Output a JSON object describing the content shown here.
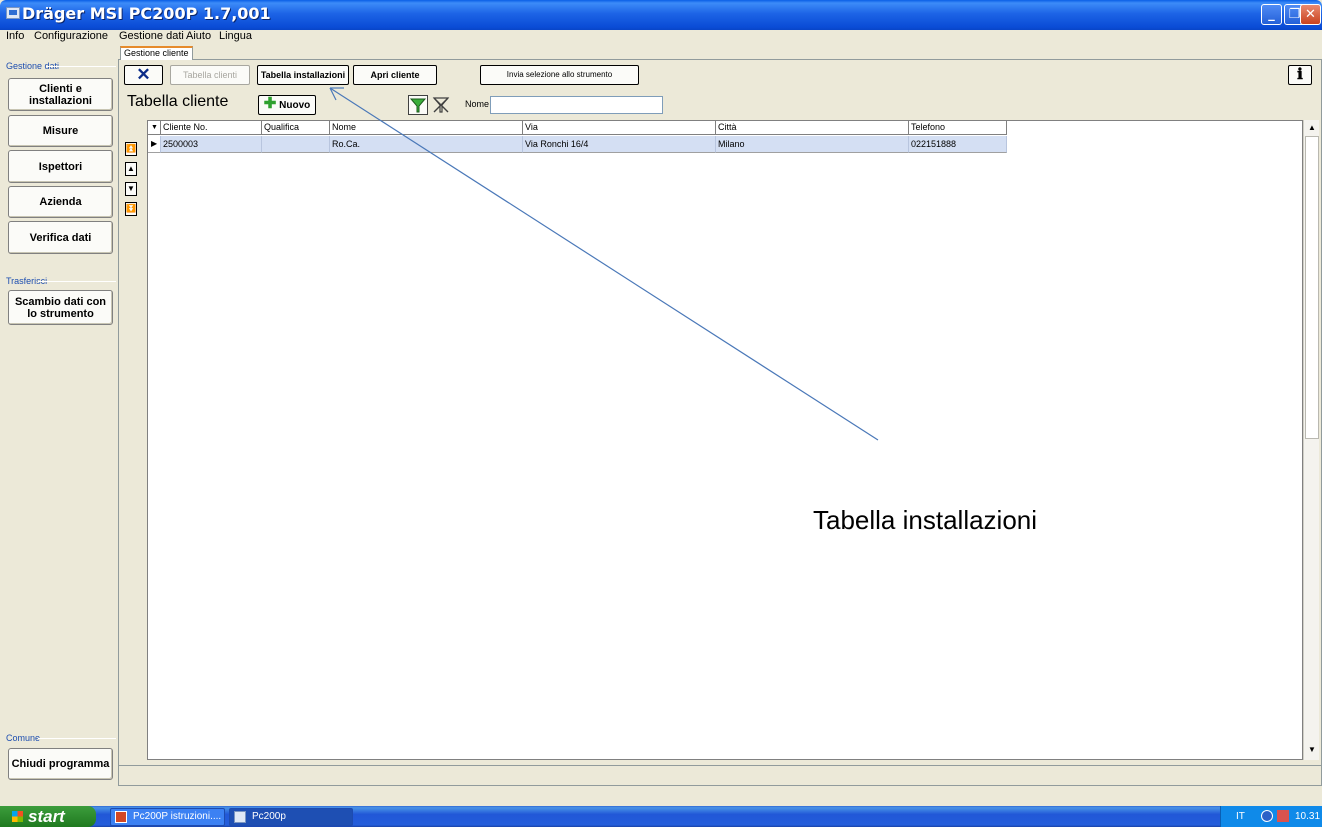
{
  "window": {
    "title": "Dräger MSI PC200P 1.7,001",
    "minimize": "_",
    "restore": "❐",
    "close": "✕"
  },
  "menu": [
    "Info",
    "Configurazione",
    "Gestione dati",
    "Aiuto",
    "Lingua"
  ],
  "sidebar": {
    "group_data": "Gestione dati",
    "group_transfer": "Trasferisci",
    "group_common": "Comune",
    "buttons": {
      "clients": "Clienti e installazioni",
      "measures": "Misure",
      "inspectors": "Ispettori",
      "company": "Azienda",
      "verify": "Verifica dati",
      "exchange": "Scambio dati con lo strumento",
      "close_program": "Chiudi programma"
    }
  },
  "tab": {
    "label": "Gestione cliente"
  },
  "toolbar": {
    "close_icon": "close-icon",
    "tabella_clienti": "Tabella clienti",
    "tabella_installazioni": "Tabella installazioni",
    "apri_cliente": "Apri cliente",
    "invia_selezione": "Invia selezione allo strumento",
    "info_icon": "info-icon"
  },
  "section": {
    "title": "Tabella cliente",
    "new_button": "Nuovo",
    "filter_label": "Nome",
    "filter_value": ""
  },
  "table": {
    "columns": [
      "Cliente No.",
      "Qualifica",
      "Nome",
      "Via",
      "Città",
      "Telefono"
    ],
    "rows": [
      [
        "2500003",
        "",
        "Ro.Ca.",
        "Via Ronchi 16/4",
        "Milano",
        "022151888"
      ]
    ]
  },
  "annotation": {
    "text": "Tabella installazioni"
  },
  "taskbar": {
    "start": "start",
    "items": [
      "Pc200P istruzioni....",
      "Pc200p"
    ],
    "lang": "IT",
    "clock": "10.31"
  },
  "colors": {
    "titlebar": "#0a4cd6",
    "selected_row": "#d4dff3",
    "annotation_line": "#4a78b8"
  }
}
